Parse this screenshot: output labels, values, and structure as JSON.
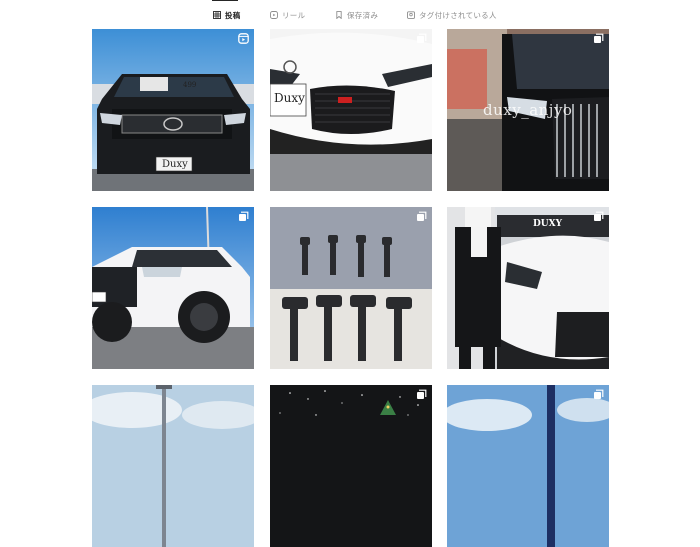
{
  "profile_tabs": [
    {
      "label": "投稿",
      "icon": "grid-icon",
      "active": true
    },
    {
      "label": "リール",
      "icon": "reels-icon",
      "active": false
    },
    {
      "label": "保存済み",
      "icon": "bookmark-icon",
      "active": false
    },
    {
      "label": "タグ付けされている人",
      "icon": "tagged-icon",
      "active": false
    }
  ],
  "posts": [
    {
      "subject": "black pickup truck front",
      "plate": "Duxy",
      "windshield_price": "499",
      "overlay_icon": "reels-icon"
    },
    {
      "subject": "white sports car front grille",
      "plate": "Duxy",
      "overlay_icon": "carousel-icon"
    },
    {
      "subject": "black minivan front",
      "watermark": "duxy_anjyo",
      "overlay_icon": "carousel-icon"
    },
    {
      "subject": "white lifted pickup truck",
      "overlay_icon": "carousel-icon"
    },
    {
      "subject": "ignition coils on cloth",
      "overlay_icon": "carousel-icon"
    },
    {
      "subject": "person with white sports car",
      "banner": "DUXY",
      "overlay_icon": "carousel-icon"
    },
    {
      "subject": "sky and light pole",
      "overlay_icon": null
    },
    {
      "subject": "night scene with lights",
      "overlay_icon": "carousel-icon"
    },
    {
      "subject": "sky and pole",
      "overlay_icon": "carousel-icon"
    }
  ]
}
